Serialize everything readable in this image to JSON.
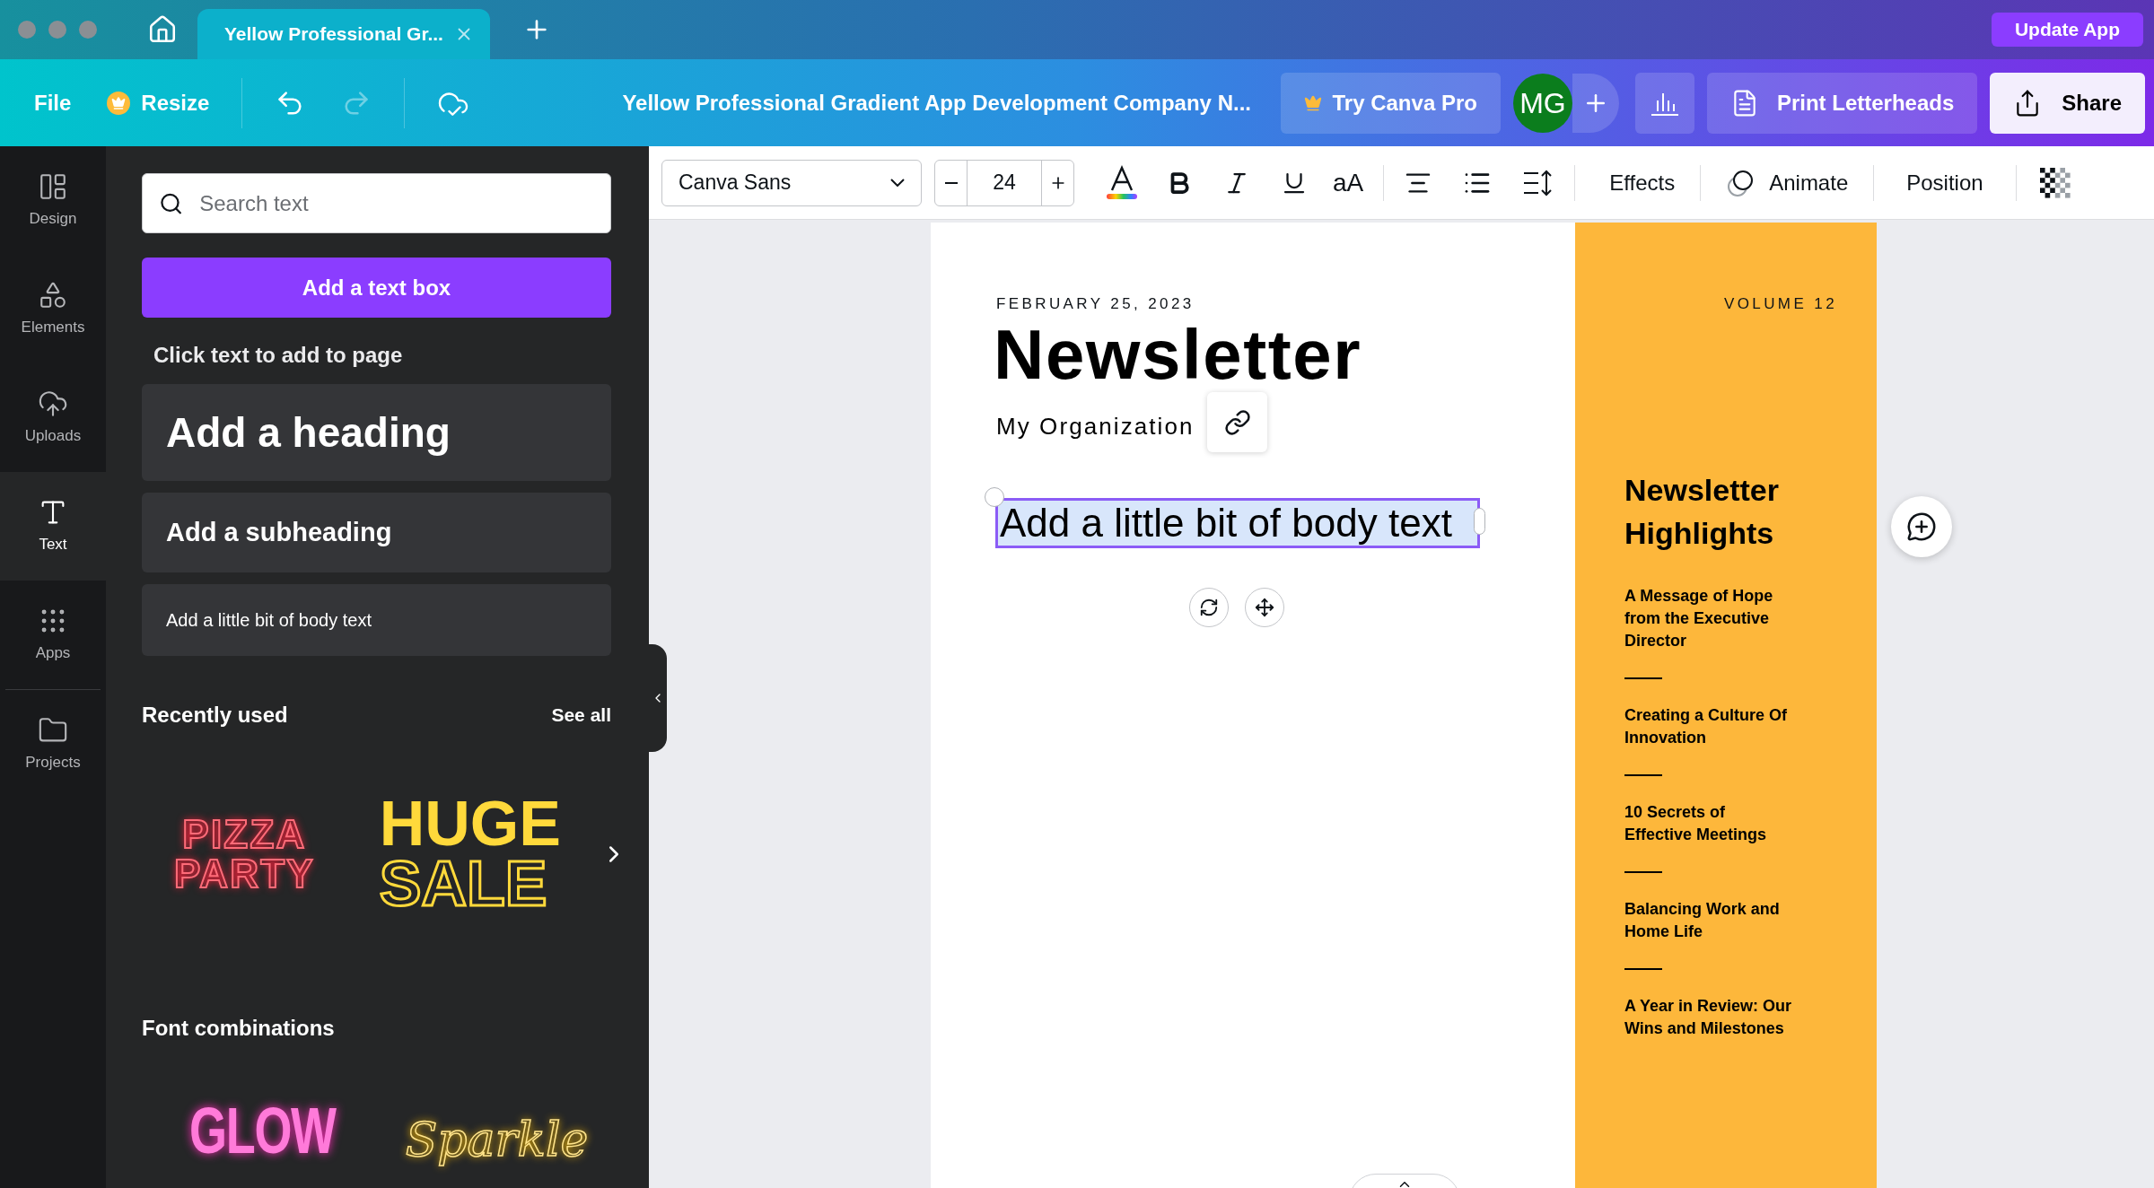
{
  "window": {
    "tab_title": "Yellow Professional Gr...",
    "update_button": "Update App"
  },
  "menu_bar": {
    "file": "File",
    "resize": "Resize",
    "undo": {
      "disabled": false
    },
    "redo": {
      "disabled": true
    },
    "document_title": "Yellow Professional Gradient App Development Company N...",
    "try_pro": "Try Canva Pro",
    "avatar": "MG",
    "print": "Print Letterheads",
    "share": "Share"
  },
  "sidebar": {
    "items": [
      {
        "kind": "design",
        "label": "Design",
        "selected": false
      },
      {
        "kind": "elements",
        "label": "Elements",
        "selected": false
      },
      {
        "kind": "uploads",
        "label": "Uploads",
        "selected": false
      },
      {
        "kind": "text",
        "label": "Text",
        "selected": true
      },
      {
        "kind": "apps",
        "label": "Apps",
        "selected": false
      },
      {
        "kind": "projects",
        "label": "Projects",
        "selected": false
      }
    ]
  },
  "text_panel": {
    "search": {
      "placeholder": "Search text"
    },
    "add_button": "Add a text box",
    "hint": "Click text to add to page",
    "presets": [
      {
        "kind": "heading",
        "label": "Add a heading"
      },
      {
        "kind": "subheading",
        "label": "Add a subheading"
      },
      {
        "kind": "body",
        "label": "Add a little bit of body text"
      }
    ],
    "recently_used": {
      "title": "Recently used",
      "see_all": "See all",
      "samples": [
        {
          "kind": "neon-red",
          "lines": [
            "PIZZA",
            "PARTY"
          ]
        },
        {
          "kind": "bold-yellow",
          "lines": [
            "HUGE",
            "SALE"
          ]
        }
      ]
    },
    "font_combinations": {
      "title": "Font combinations",
      "samples": [
        {
          "kind": "neon-pink",
          "lines": [
            "GLOW"
          ]
        },
        {
          "kind": "script-gold",
          "lines": [
            "Sparkle"
          ]
        }
      ]
    }
  },
  "editor_toolbar": {
    "font": "Canva Sans",
    "font_size": "24",
    "case_toggle": "aA",
    "effects": "Effects",
    "animate": "Animate",
    "position": "Position"
  },
  "page": {
    "date": "FEBRUARY 25, 2023",
    "title": "Newsletter",
    "organization": "My Organization",
    "body_text": {
      "text": "Add a little bit of body text",
      "selected": true
    },
    "side": {
      "volume": "VOLUME 12",
      "heading": "Newsletter Highlights",
      "items": [
        "A Message of Hope from the Executive Director",
        "Creating a Culture Of Innovation",
        "10 Secrets of Effective Meetings",
        "Balancing Work and Home Life",
        "A Year in Review: Our Wins and Milestones"
      ]
    }
  }
}
